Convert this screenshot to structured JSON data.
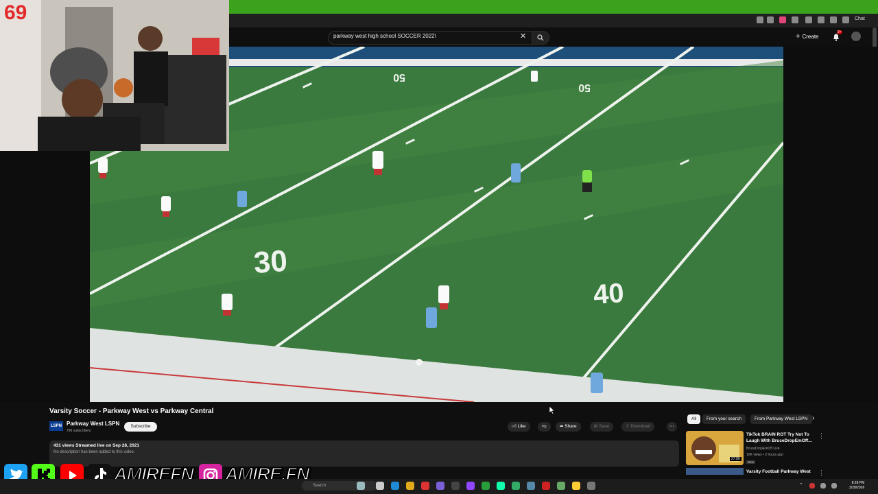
{
  "stream": {
    "counter": "69",
    "social": {
      "handle_1": "AMIREFN",
      "handle_2": "AMIRE.FN"
    }
  },
  "browser": {
    "search_value": "parkway west high school SOCCER 2022\\",
    "create_label": "Create",
    "notif_badge": "9+",
    "chat_label": "Chat"
  },
  "field": {
    "yard_30": "30",
    "yard_40": "40",
    "yard_50a": "50",
    "yard_50b": "50"
  },
  "video": {
    "title": "Varsity Soccer - Parkway West vs Parkway Central",
    "channel_logo": "LSPN",
    "channel_name": "Parkway West LSPN",
    "subscribers": "796 subscribers",
    "subscribe_label": "Subscribe",
    "like_label": "Like",
    "share_label": "Share",
    "save_label": "Save",
    "download_label": "Download",
    "desc_stats": "431 views  Streamed live on Sep 28, 2021",
    "desc_text": "No description has been added to this video."
  },
  "sidebar": {
    "chips": [
      "All",
      "From your search",
      "From Parkway West LSPN"
    ],
    "rec1": {
      "title": "TikTok BRAIN ROT Try Not To Laugh With BruceDropEmOff...",
      "channel": "BruceDropEmOff Live",
      "meta": "10K views • 2 hours ago",
      "badge": "New",
      "duration": "27:09"
    },
    "rec2": {
      "title": "Varsity Football Parkway West"
    }
  },
  "taskbar": {
    "search": "Search",
    "time": "8:28 PM",
    "date": "3/28/2026"
  },
  "colors": {
    "stream_bar_green": "#3aa21b",
    "field_green": "#3b7a3e",
    "counter_red": "#e32a2a",
    "home_jersey": "#ffffff",
    "away_jersey": "#6fa8dc"
  }
}
